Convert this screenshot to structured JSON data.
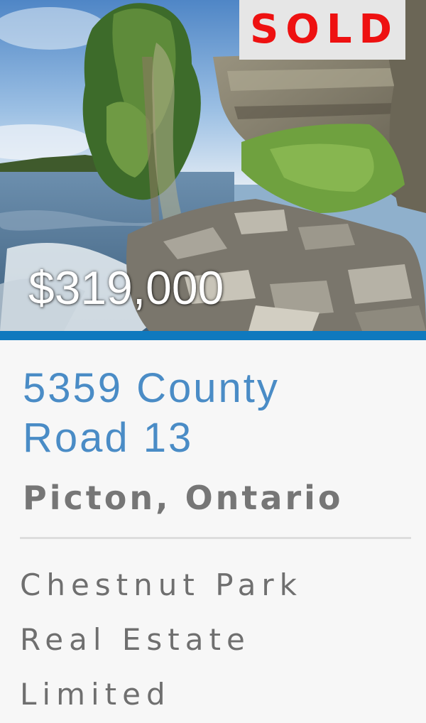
{
  "listing": {
    "status_badge": "SOLD",
    "price": "$319,000",
    "address": "5359 County Road 13",
    "city": "Picton, Ontario",
    "brokerage": "Chestnut Park Real Estate Limited",
    "photo_description_icon": "listing-photo"
  },
  "colors": {
    "accent": "#0f79be",
    "address_text": "#4a8cc6",
    "sold_text": "#ee1111",
    "sold_background": "#e6e6e6",
    "secondary_text": "#767676"
  }
}
